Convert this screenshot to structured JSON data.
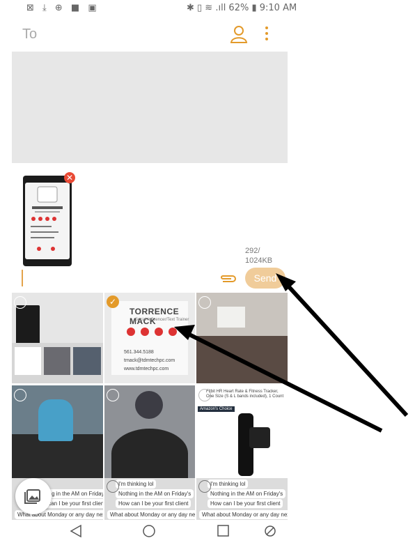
{
  "status_bar": {
    "left_icons": "⊠ ⤓ ⊕ ■ ▣",
    "right_text": "✱ ▯ ≋ .ıll 62% ▮ 9:10 AM"
  },
  "compose": {
    "to_label": "To",
    "contact_icon": "contact-icon",
    "more_icon": "more-vertical-icon"
  },
  "attachment": {
    "size_line1": "292/",
    "size_line2": "1024KB",
    "send_label": "Send",
    "card_name": "TORRENCE MACK"
  },
  "gallery": {
    "card_name": "TORRENCE MACK",
    "card_subtitle": "Social Influencer/Text Trainer",
    "card_phone": "561.344.5188",
    "card_email": "tmack@tdmtechpc.com",
    "card_web": "www.tdmtechpc.com",
    "product_text": "Fitbit HR Heart Rate & Fitness Tracker, One Size (S & L bands included), 1 Count",
    "product_badge": "Amazon's Choice",
    "chat_1": "I'm thinking lol",
    "chat_2": "Nothing in the AM on Friday's",
    "chat_3": "How can I be your first client",
    "chat_4": "What about Monday or any day next week"
  },
  "colors": {
    "accent": "#e39a2a",
    "send_bg": "#f0cc9a",
    "remove": "#e94a35"
  }
}
